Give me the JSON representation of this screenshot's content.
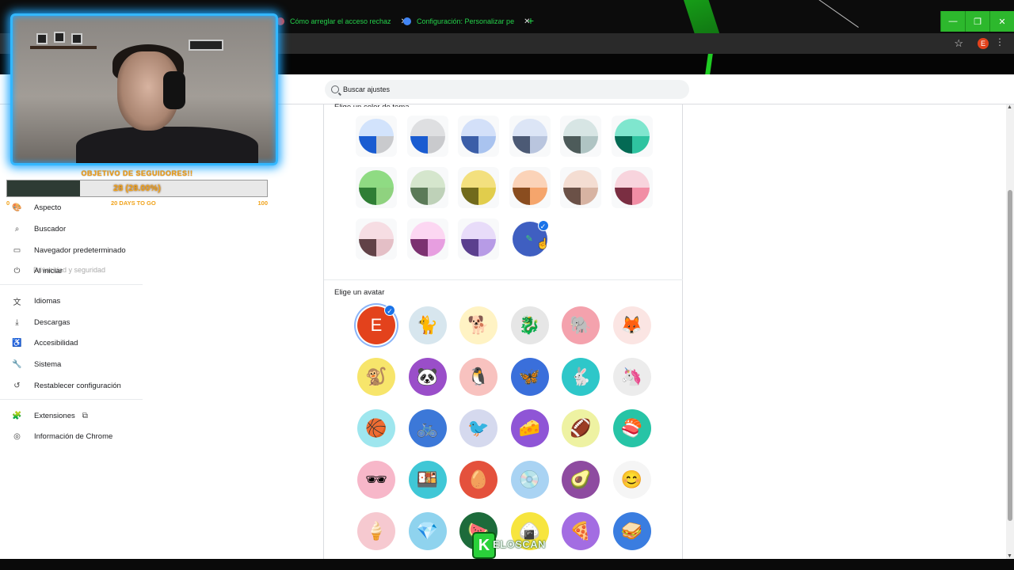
{
  "browser": {
    "tabs": [
      {
        "title": "Cómo arreglar el acceso rechaz",
        "close": "✕"
      },
      {
        "title": "Configuración: Personalizar pe",
        "close": "✕"
      }
    ],
    "new_tab": "+",
    "window_controls": {
      "minimize": "—",
      "restore": "❐",
      "close": "✕"
    },
    "profile_initial": "E",
    "star": "☆",
    "menu": "⋮"
  },
  "settings": {
    "search_placeholder": "Buscar ajustes"
  },
  "sidebar": {
    "faded_item": "Privacidad y seguridad",
    "items": [
      {
        "label": "Aspecto",
        "icon": "palette-icon",
        "glyph": "🎨"
      },
      {
        "label": "Buscador",
        "icon": "search-icon",
        "glyph": "⌕"
      },
      {
        "label": "Navegador predeterminado",
        "icon": "browser-window-icon",
        "glyph": "▭"
      },
      {
        "label": "Al iniciar",
        "icon": "power-icon",
        "glyph": "⏻"
      },
      {
        "label": "Idiomas",
        "icon": "translate-icon",
        "glyph": "文"
      },
      {
        "label": "Descargas",
        "icon": "download-icon",
        "glyph": "⤓"
      },
      {
        "label": "Accesibilidad",
        "icon": "accessibility-icon",
        "glyph": "♿"
      },
      {
        "label": "Sistema",
        "icon": "wrench-icon",
        "glyph": "🔧"
      },
      {
        "label": "Restablecer configuración",
        "icon": "reset-icon",
        "glyph": "↺"
      },
      {
        "label": "Extensiones",
        "icon": "puzzle-icon",
        "glyph": "🧩"
      },
      {
        "label": "Información de Chrome",
        "icon": "chrome-icon",
        "glyph": "◎"
      }
    ],
    "extensions_link_glyph": "⧉"
  },
  "overlay": {
    "goal_title": "OBJETIVO DE SEGUIDORES!!",
    "goal_count": "28 (28.00%)",
    "goal_progress_percent": 28,
    "goal_min": "0",
    "goal_days": "20 DAYS TO GO",
    "goal_max": "100",
    "watermark_letter": "K",
    "watermark_text": "ELOSCAN"
  },
  "theme": {
    "section_label": "Elige un color de tema",
    "colors": [
      {
        "top": "#d2e3fc",
        "bl": "#1a5cd1",
        "br": "#c9cacd"
      },
      {
        "top": "#dedfe1",
        "bl": "#1a5cd1",
        "br": "#c9cacd"
      },
      {
        "top": "#d3e0f9",
        "bl": "#3b5ea8",
        "br": "#a9c3ef"
      },
      {
        "top": "#dce5f6",
        "bl": "#4c5a75",
        "br": "#b9c5de"
      },
      {
        "top": "#d7e5e4",
        "bl": "#4d5b5a",
        "br": "#afc4c3"
      },
      {
        "top": "#7fe6ce",
        "bl": "#046a54",
        "br": "#2fc3a0"
      },
      {
        "top": "#8fdb83",
        "bl": "#2f7e35",
        "br": "#8fd27f"
      },
      {
        "top": "#d5e6cd",
        "bl": "#5b7a58",
        "br": "#bed1b8"
      },
      {
        "top": "#f3e07e",
        "bl": "#716a1c",
        "br": "#e1cd4c"
      },
      {
        "top": "#fbd3b8",
        "bl": "#8a4d1f",
        "br": "#f5a56c"
      },
      {
        "top": "#f4ddd2",
        "bl": "#6b5147",
        "br": "#d7b3a2"
      },
      {
        "top": "#f8d4dd",
        "bl": "#7a2e42",
        "br": "#f18ea5"
      },
      {
        "top": "#f6dde3",
        "bl": "#614247",
        "br": "#e4bfc6"
      },
      {
        "top": "#fcd7f2",
        "bl": "#7b3170",
        "br": "#e79ee0"
      },
      {
        "top": "#e8dcf9",
        "bl": "#5b3f8e",
        "br": "#b79be6"
      }
    ],
    "custom_pencil": "✎",
    "check": "✓",
    "cursor": "☝"
  },
  "avatar_section": {
    "section_label": "Elige un avatar",
    "selected_letter": "E",
    "avatars": [
      {
        "name": "avatar-letter",
        "bg": "#e3421c",
        "glyph": "E",
        "selected": true
      },
      {
        "name": "avatar-cat",
        "bg": "#d7e6ee",
        "glyph": "🐈"
      },
      {
        "name": "avatar-corgi",
        "bg": "#fff3c4",
        "glyph": "🐕"
      },
      {
        "name": "avatar-dragon",
        "bg": "#e6e6e6",
        "glyph": "🐉"
      },
      {
        "name": "avatar-elephant",
        "bg": "#f4a2ad",
        "glyph": "🐘"
      },
      {
        "name": "avatar-fox",
        "bg": "#fbe5e3",
        "glyph": "🦊"
      },
      {
        "name": "avatar-monkey",
        "bg": "#f7e56b",
        "glyph": "🐒"
      },
      {
        "name": "avatar-panda",
        "bg": "#9a4ec9",
        "glyph": "🐼"
      },
      {
        "name": "avatar-penguin",
        "bg": "#f8c2bf",
        "glyph": "🐧"
      },
      {
        "name": "avatar-butterfly",
        "bg": "#3a6fdb",
        "glyph": "🦋"
      },
      {
        "name": "avatar-rabbit",
        "bg": "#2ec7c9",
        "glyph": "🐇"
      },
      {
        "name": "avatar-unicorn",
        "bg": "#ececec",
        "glyph": "🦄"
      },
      {
        "name": "avatar-basketball",
        "bg": "#9ee6ee",
        "glyph": "🏀"
      },
      {
        "name": "avatar-bicycle",
        "bg": "#3c78d8",
        "glyph": "🚲"
      },
      {
        "name": "avatar-bird",
        "bg": "#d5d9ee",
        "glyph": "🐦"
      },
      {
        "name": "avatar-cheese",
        "bg": "#8f55d6",
        "glyph": "🧀"
      },
      {
        "name": "avatar-football",
        "bg": "#eef2a2",
        "glyph": "🏈"
      },
      {
        "name": "avatar-sushi-plate",
        "bg": "#27c4a6",
        "glyph": "🍣"
      },
      {
        "name": "avatar-sunglasses",
        "bg": "#f7b7c9",
        "glyph": "🕶"
      },
      {
        "name": "avatar-sushi",
        "bg": "#3fc7d6",
        "glyph": "🍱"
      },
      {
        "name": "avatar-tamagotchi",
        "bg": "#e4513c",
        "glyph": "🥚"
      },
      {
        "name": "avatar-vinyl",
        "bg": "#a9d3f3",
        "glyph": "💿"
      },
      {
        "name": "avatar-avocado",
        "bg": "#8e4ba0",
        "glyph": "🥑"
      },
      {
        "name": "avatar-smile",
        "bg": "#f5f5f5",
        "glyph": "😊"
      },
      {
        "name": "avatar-ice-cream",
        "bg": "#f6c9d0",
        "glyph": "🍦"
      },
      {
        "name": "avatar-diamond",
        "bg": "#8fd3ee",
        "glyph": "💎"
      },
      {
        "name": "avatar-watermelon",
        "bg": "#1d6b3b",
        "glyph": "🍉"
      },
      {
        "name": "avatar-onigiri",
        "bg": "#f7e53e",
        "glyph": "🍙"
      },
      {
        "name": "avatar-pizza",
        "bg": "#a36de2",
        "glyph": "🍕"
      },
      {
        "name": "avatar-sandwich",
        "bg": "#3a7de0",
        "glyph": "🥪"
      }
    ]
  }
}
